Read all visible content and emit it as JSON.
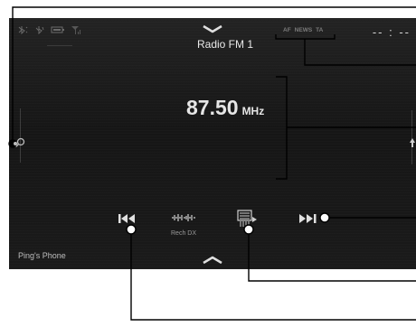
{
  "header": {
    "station_name": "Radio FM 1",
    "clock": "-- : --",
    "flags": [
      "AF",
      "NEWS",
      "TA"
    ]
  },
  "tuner": {
    "frequency": "87.50",
    "unit": "MHz"
  },
  "controls": {
    "rech_dx_label": "Rech DX"
  },
  "footer": {
    "device_name": "Ping's Phone"
  },
  "colors": {
    "screen_bg": "#1a1a1a",
    "text": "#e6e6e6",
    "callout": "#000000"
  },
  "icons": [
    "bluetooth-phone-icon",
    "bluetooth-audio-icon",
    "battery-icon",
    "signal-icon",
    "search-icon",
    "chevron-up-icon",
    "chevron-down-icon",
    "previous-icon",
    "next-icon",
    "rech-dx-icon",
    "preset-list-icon",
    "tuning-arrow-icon"
  ]
}
